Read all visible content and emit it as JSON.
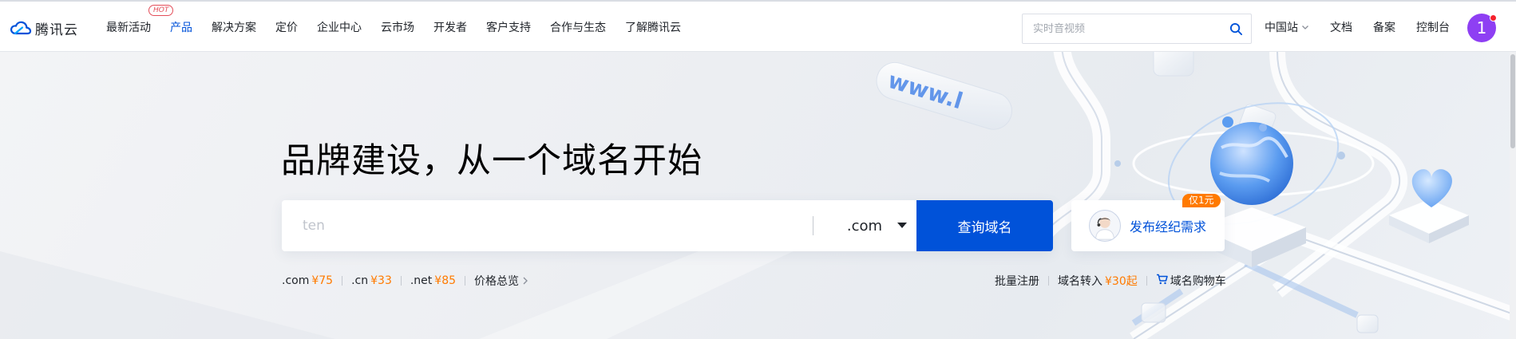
{
  "brand": {
    "name": "腾讯云",
    "logo_icon": "cloud-logo-icon"
  },
  "nav": {
    "items": [
      {
        "label": "最新活动",
        "badge": "HOT"
      },
      {
        "label": "产品",
        "active": true
      },
      {
        "label": "解决方案"
      },
      {
        "label": "定价"
      },
      {
        "label": "企业中心"
      },
      {
        "label": "云市场"
      },
      {
        "label": "开发者"
      },
      {
        "label": "客户支持"
      },
      {
        "label": "合作与生态"
      },
      {
        "label": "了解腾讯云"
      }
    ]
  },
  "search": {
    "placeholder": "实时音视频",
    "icon": "search-icon"
  },
  "right_nav": {
    "site": "中国站",
    "docs": "文档",
    "filing": "备案",
    "console": "控制台"
  },
  "user": {
    "avatar_initial": "1",
    "accent": "#8e3ff3"
  },
  "hero": {
    "title": "品牌建设，从一个域名开始",
    "domain_input": {
      "value": "",
      "placeholder": "ten"
    },
    "suffix_selected": ".com",
    "query_button": "查询域名",
    "broker": {
      "label": "发布经纪需求",
      "badge": "仅1元"
    },
    "prices": [
      {
        "suffix": ".com",
        "price": "¥75"
      },
      {
        "suffix": ".cn",
        "price": "¥33"
      },
      {
        "suffix": ".net",
        "price": "¥85"
      }
    ],
    "price_overview": "价格总览",
    "actions": {
      "bulk_register": "批量注册",
      "transfer_label": "域名转入",
      "transfer_price": "¥30起",
      "cart": "域名购物车"
    }
  },
  "colors": {
    "primary": "#0052d9",
    "price": "#ff7a00",
    "hot": "#e34d59"
  }
}
